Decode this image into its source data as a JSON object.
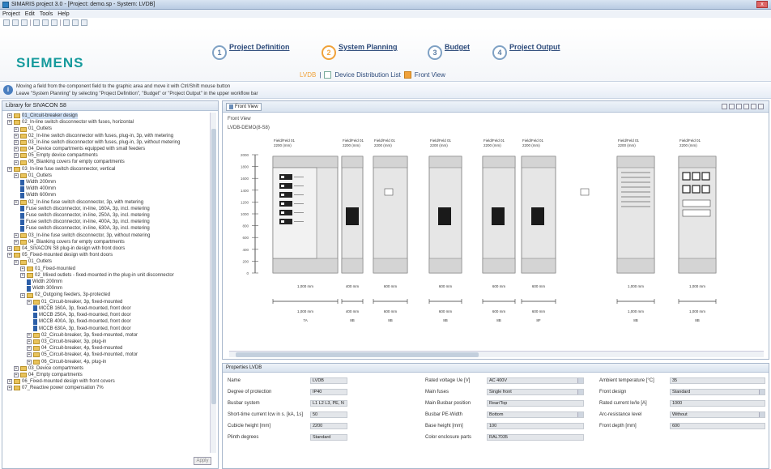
{
  "window": {
    "title": "SIMARIS project 3.0 - [Project: demo.sp - System: LVDB]"
  },
  "menu": [
    "Project",
    "Edit",
    "Tools",
    "Help"
  ],
  "brand": "SIEMENS",
  "steps": [
    {
      "num": "1",
      "label": "Project Definition"
    },
    {
      "num": "2",
      "label": "System Planning"
    },
    {
      "num": "3",
      "label": "Budget"
    },
    {
      "num": "4",
      "label": "Project Output"
    }
  ],
  "subnav": {
    "system": "LVDB",
    "sep": "|",
    "dist_list": "Device Distribution List",
    "front_view": "Front View"
  },
  "info": {
    "line1": "Moving a field from the component field to the graphic area and move it with Ctrl/Shift mouse button",
    "line2": "Leave \"System Planning\" by selecting \"Project Definition\", \"Budget\" or \"Project Output\" in the upper workflow bar"
  },
  "library": {
    "title": "Library for SIVACON S8",
    "apply": "Apply",
    "items": [
      {
        "text": "01_Circuit-breaker design",
        "kind": "folder",
        "sel": true
      },
      {
        "text": "02_In-line switch disconnector with fuses, horizontal",
        "kind": "folder"
      },
      {
        "text": "01_Outlets",
        "kind": "folder"
      },
      {
        "text": "02_In-line switch disconnector with fuses, plug-in, 3p, with metering",
        "kind": "folder"
      },
      {
        "text": "03_In-line switch disconnector with fuses, plug-in, 3p, without metering",
        "kind": "folder"
      },
      {
        "text": "04_Device compartments equipped with small feeders",
        "kind": "folder"
      },
      {
        "text": "05_Empty device compartments",
        "kind": "folder"
      },
      {
        "text": "06_Blanking covers for empty compartments",
        "kind": "folder"
      },
      {
        "text": "03_In-line fuse switch disconnector, vertical",
        "kind": "folder"
      },
      {
        "text": "01_Outlets",
        "kind": "folder"
      },
      {
        "text": "Width 200mm",
        "kind": "doc"
      },
      {
        "text": "Width 400mm",
        "kind": "doc"
      },
      {
        "text": "Width 600mm",
        "kind": "doc"
      },
      {
        "text": "02_In-line fuse switch disconnector, 3p, with metering",
        "kind": "folder"
      },
      {
        "text": "Fuse switch disconnector, in-line, 160A, 3p, incl. metering",
        "kind": "doc"
      },
      {
        "text": "Fuse switch disconnector, in-line, 250A, 3p, incl. metering",
        "kind": "doc"
      },
      {
        "text": "Fuse switch disconnector, in-line, 400A, 3p, incl. metering",
        "kind": "doc"
      },
      {
        "text": "Fuse switch disconnector, in-line, 630A, 3p, incl. metering",
        "kind": "doc"
      },
      {
        "text": "03_In-line fuse switch disconnector, 3p, without metering",
        "kind": "folder"
      },
      {
        "text": "04_Blanking covers for empty compartments",
        "kind": "folder"
      },
      {
        "text": "04_SIVACON S8 plug-in design with front doors",
        "kind": "folder"
      },
      {
        "text": "05_Fixed-mounted design with front doors",
        "kind": "folder"
      },
      {
        "text": "01_Outlets",
        "kind": "folder"
      },
      {
        "text": "01_Fixed-mounted",
        "kind": "folder"
      },
      {
        "text": "02_Mixed outlets - fixed-mounted in the plug-in unit disconnector",
        "kind": "folder"
      },
      {
        "text": "Width 200mm",
        "kind": "doc"
      },
      {
        "text": "Width 300mm",
        "kind": "doc"
      },
      {
        "text": "02_Outgoing feeders, 3p-protected",
        "kind": "folder"
      },
      {
        "text": "01_Circuit-breaker, 3p, fixed-mounted",
        "kind": "folder"
      },
      {
        "text": "MCCB 160A, 3p, fixed-mounted, front door",
        "kind": "doc"
      },
      {
        "text": "MCCB 250A, 3p, fixed-mounted, front door",
        "kind": "doc"
      },
      {
        "text": "MCCB 400A, 3p, fixed-mounted, front door",
        "kind": "doc"
      },
      {
        "text": "MCCB 630A, 3p, fixed-mounted, front door",
        "kind": "doc"
      },
      {
        "text": "02_Circuit-breaker, 3p, fixed-mounted, motor",
        "kind": "folder"
      },
      {
        "text": "03_Circuit-breaker, 3p, plug-in",
        "kind": "folder"
      },
      {
        "text": "04_Circuit-breaker, 4p, fixed-mounted",
        "kind": "folder"
      },
      {
        "text": "05_Circuit-breaker, 4p, fixed-mounted, motor",
        "kind": "folder"
      },
      {
        "text": "06_Circuit-breaker, 4p, plug-in",
        "kind": "folder"
      },
      {
        "text": "03_Device compartments",
        "kind": "folder"
      },
      {
        "text": "04_Empty compartments",
        "kind": "folder"
      },
      {
        "text": "06_Fixed-mounted design with front covers",
        "kind": "folder"
      },
      {
        "text": "07_Reactive power compensation 7%",
        "kind": "folder"
      }
    ]
  },
  "front_view": {
    "tab": "Front View",
    "title": "Front View",
    "subtitle": "LVDB-DEMO(8-S8)",
    "field_label": "Field/Feld 01",
    "field_sub": "2200 (mm)",
    "widths": [
      "1,000 mm",
      "400 mm",
      "600 mm",
      "600 mm",
      "600 mm",
      "600 mm",
      "1,000 mm",
      "1,000 mm"
    ],
    "depths": [
      "1,000 mm",
      "400 mm",
      "600 mm",
      "600 mm",
      "600 mm",
      "600 mm",
      "1,000 mm",
      "1,000 mm"
    ],
    "types": [
      "7A",
      "8B",
      "8B",
      "8B",
      "8B",
      "8F",
      "8B",
      "8B"
    ],
    "scale": [
      "2000",
      "1800",
      "1600",
      "1400",
      "1200",
      "1000",
      "800",
      "600",
      "400",
      "200",
      "0"
    ]
  },
  "properties": {
    "title": "Properties LVDB",
    "fields": [
      {
        "label": "Name",
        "value": "LVDB"
      },
      {
        "label": "Degree of protection",
        "value": "IP40"
      },
      {
        "label": "Busbar system",
        "value": "L1 L2 L3, PE, N"
      },
      {
        "label": "Short-time current Icw in s. [kA, 1s]",
        "value": "50"
      },
      {
        "label": "Cubicle height [mm]",
        "value": "2200"
      },
      {
        "label": "Plinth degrees",
        "value": "Standard"
      },
      {
        "label": "Rated voltage Ue [V]",
        "value": "AC 400V"
      },
      {
        "label": "Main fuses",
        "value": "Single front"
      },
      {
        "label": "Main Busbar position",
        "value": "Rear/Top"
      },
      {
        "label": "Busbar PE-Width",
        "value": "Bottom"
      },
      {
        "label": "Base height [mm]",
        "value": "100"
      },
      {
        "label": "Color enclosure parts",
        "value": "RAL7035"
      },
      {
        "label": "Ambient temperature [°C]",
        "value": "35"
      },
      {
        "label": "Front design",
        "value": "Standard"
      },
      {
        "label": "Rated current Ie/Ie [A]",
        "value": "1000"
      },
      {
        "label": "Arc-resistance level",
        "value": "Without"
      },
      {
        "label": "Front depth [mm]",
        "value": "600"
      }
    ]
  },
  "colors": {
    "brand": "#159a9c",
    "accent": "#f0a23a",
    "link": "#2c4a7a"
  }
}
